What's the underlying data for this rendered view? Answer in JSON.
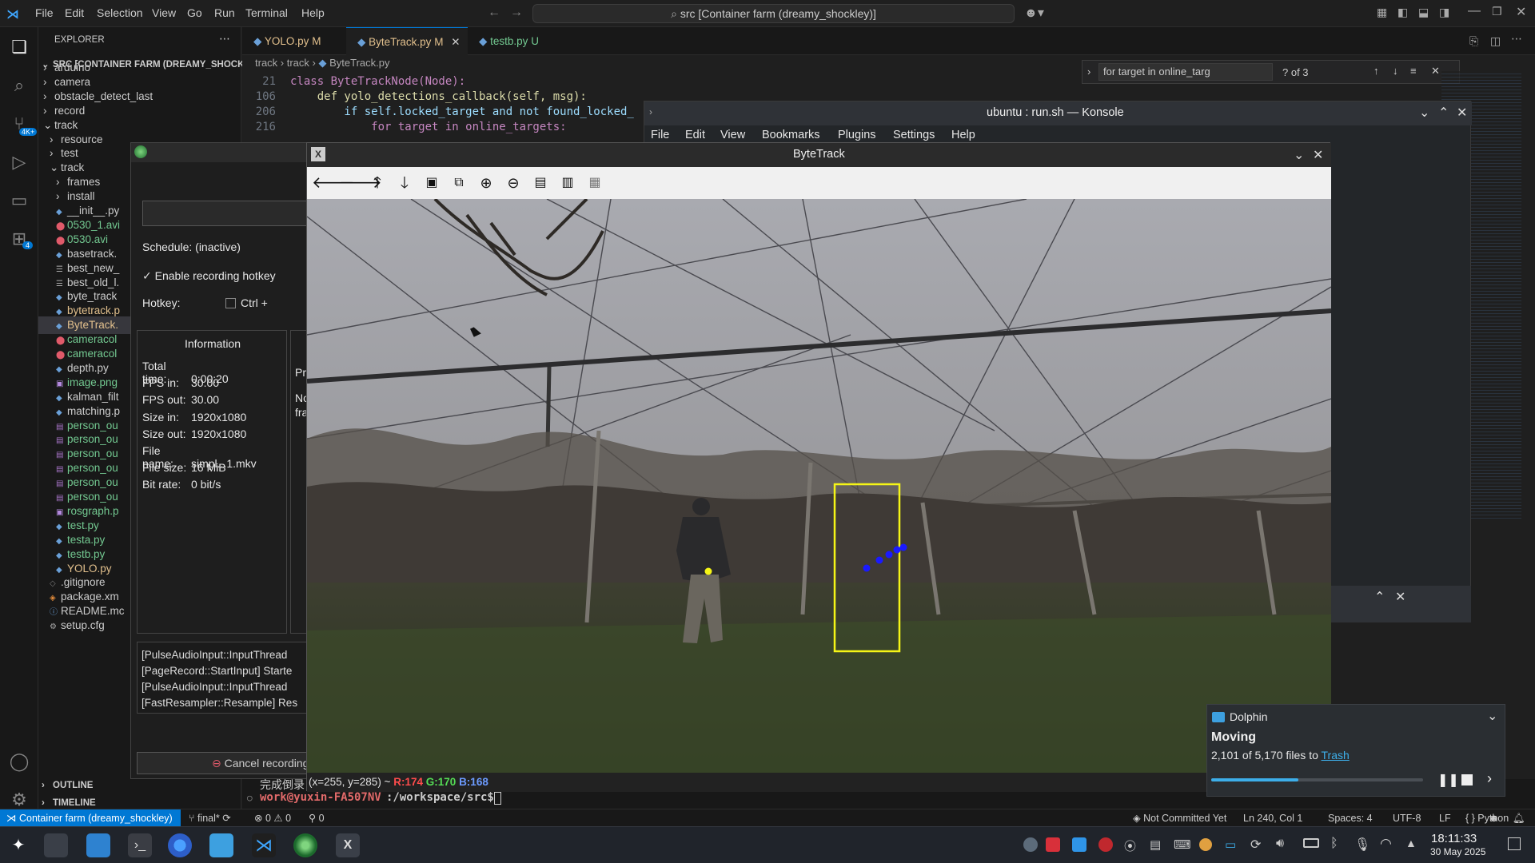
{
  "vscode": {
    "menu": [
      "File",
      "Edit",
      "Selection",
      "View",
      "Go",
      "Run",
      "Terminal",
      "Help"
    ],
    "command_center": "src [Container farm (dreamy_shockley)]",
    "sidebar": {
      "title": "EXPLORER",
      "root": "SRC [CONTAINER FARM (DREAMY_SHOCK...",
      "items": [
        "arduino",
        "camera",
        "obstacle_detect_last",
        "record",
        "track",
        "resource",
        "test",
        "track",
        "frames",
        "install",
        "__init__.py",
        "0530_1.avi",
        "0530.avi",
        "basetrack.",
        "best_new_",
        "best_old_l.",
        "byte_track",
        "bytetrack.p",
        "ByteTrack.",
        "cameracol",
        "cameracol",
        "depth.py",
        "image.png",
        "kalman_filt",
        "matching.p",
        "person_ou",
        "person_ou",
        "person_ou",
        "person_ou",
        "person_ou",
        "person_ou",
        "rosgraph.p",
        "test.py",
        "testa.py",
        "testb.py",
        "YOLO.py",
        ".gitignore",
        "package.xm",
        "README.mc",
        "setup.cfg"
      ],
      "outline": "OUTLINE",
      "timeline": "TIMELINE"
    },
    "tabs": [
      {
        "label": "YOLO.py",
        "badge": "M"
      },
      {
        "label": "ByteTrack.py",
        "badge": "M"
      },
      {
        "label": "testb.py",
        "badge": "U"
      }
    ],
    "breadcrumb": [
      "track",
      "track",
      "ByteTrack.py"
    ],
    "code": [
      {
        "ln": "21",
        "text": "class ByteTrackNode(Node):"
      },
      {
        "ln": "106",
        "text": "    def yolo_detections_callback(self, msg):"
      },
      {
        "ln": "206",
        "text": "        if self.locked_target and not found_locked_"
      },
      {
        "ln": "216",
        "text": "            for target in online_targets:"
      }
    ],
    "find": {
      "query": "for target in online_targ",
      "result": "? of 3"
    },
    "terminal_prompt": "work@yuxin-FA507NV",
    "terminal_path": ":/workspace/src$",
    "terminal_cjk": "完成倒录",
    "status": {
      "remote": "Container farm (dreamy_shockley)",
      "branch": "final*",
      "errors": "0",
      "warnings": "0",
      "ports": "0",
      "commit": "Not Committed Yet",
      "position": "Ln 240, Col 1",
      "spaces": "Spaces: 4",
      "encoding": "UTF-8",
      "eol": "LF",
      "language": "Python"
    }
  },
  "konsole": {
    "title": "ubuntu : run.sh — Konsole",
    "menu": [
      "File",
      "Edit",
      "View",
      "Bookmarks",
      "Plugins",
      "Settings",
      "Help"
    ]
  },
  "ssr": {
    "schedule": "Schedule: (inactive)",
    "enable_hotkey": "Enable recording hotkey",
    "hotkey_label": "Hotkey:",
    "hotkey_value": "Ctrl +",
    "info_title": "Information",
    "info": [
      {
        "k": "Total time:",
        "v": "0:00:20"
      },
      {
        "k": "FPS in:",
        "v": "30.00"
      },
      {
        "k": "FPS out:",
        "v": "30.00"
      },
      {
        "k": "Size in:",
        "v": "1920x1080"
      },
      {
        "k": "Size out:",
        "v": "1920x1080"
      },
      {
        "k": "File name:",
        "v": "simpl...1.mkv"
      },
      {
        "k": "File size:",
        "v": "16 MiB"
      },
      {
        "k": "Bit rate:",
        "v": "0 bit/s"
      }
    ],
    "side_text": [
      "Pr",
      "No",
      "fra"
    ],
    "log": [
      "[PulseAudioInput::InputThread",
      "[PageRecord::StartInput] Starte",
      "[PulseAudioInput::InputThread",
      "[FastResampler::Resample] Res"
    ],
    "cancel": "Cancel recording"
  },
  "bytetrack": {
    "title": "ByteTrack",
    "pixel_readout": {
      "pos": "(x=255, y=285) ~",
      "r": "R:174",
      "g": "G:170",
      "b": "B:168"
    }
  },
  "dolphin": {
    "app": "Dolphin",
    "title": "Moving",
    "detail": "2,101 of 5,170 files to",
    "link": "Trash",
    "progress": 0.41
  },
  "taskbar": {
    "time": "18:11:33",
    "date": "30 May 2025"
  },
  "colors": {
    "accent": "#0078d4",
    "tracking_box": "#f5f516",
    "track_points": "#1a1aff",
    "modified": "#e2c08d",
    "untracked": "#73c991"
  }
}
